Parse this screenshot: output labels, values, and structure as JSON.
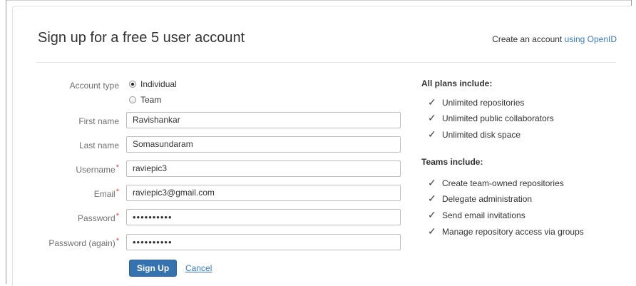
{
  "header": {
    "title": "Sign up for a free 5 user account",
    "openid_prefix": "Create an account ",
    "openid_link": "using OpenID"
  },
  "form": {
    "account_type_label": "Account type",
    "account_type_options": [
      "Individual",
      "Team"
    ],
    "account_type_selected": "Individual",
    "first_name_label": "First name",
    "first_name_value": "Ravishankar",
    "last_name_label": "Last name",
    "last_name_value": "Somasundaram",
    "username_label": "Username",
    "username_value": "raviepic3",
    "email_label": "Email",
    "email_value": "raviepic3@gmail.com",
    "password_label": "Password",
    "password_value": "••••••••••",
    "password_again_label": "Password (again)",
    "password_again_value": "••••••••••",
    "required_marker": "*",
    "signup_label": "Sign Up",
    "cancel_label": "Cancel"
  },
  "sidebar": {
    "plans_heading": "All plans include:",
    "plans_items": [
      "Unlimited repositories",
      "Unlimited public collaborators",
      "Unlimited disk space"
    ],
    "teams_heading": "Teams include:",
    "teams_items": [
      "Create team-owned repositories",
      "Delegate administration",
      "Send email invitations",
      "Manage repository access via groups"
    ],
    "check_glyph": "✓"
  },
  "colors": {
    "link": "#3a7bbf",
    "primary_button": "#3572b0",
    "required": "#d04437"
  }
}
